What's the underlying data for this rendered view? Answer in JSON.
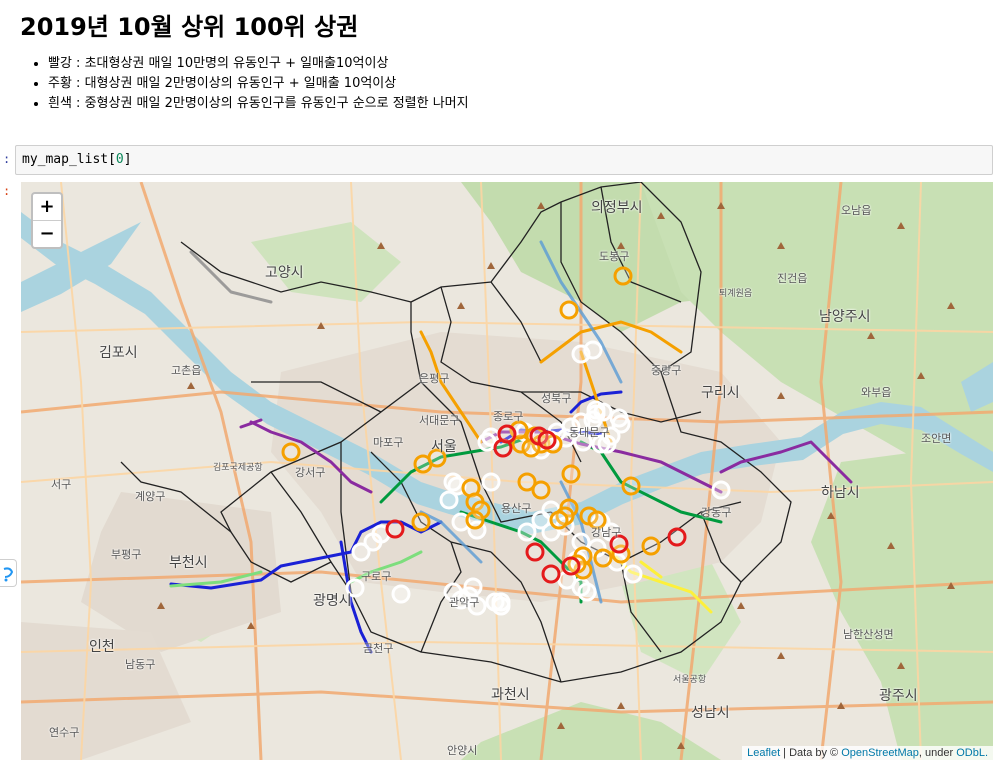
{
  "notebook": {
    "title": "2019년 10월 상위 100위 상권",
    "legend": [
      "빨강 : 초대형상권 매일 10만명의 유동인구 + 일매출10억이상",
      "주황 : 대형상권 매일 2만명이상의 유동인구 + 일매출 10억이상",
      "흰색 : 중형상권 매일 2만명이상의 유동인구를 유동인구 순으로 정렬한 나머지"
    ],
    "code_prefix": "my_map_list[",
    "code_index": "0",
    "code_suffix": "]",
    "in_prompt": ":",
    "out_prompt": ":"
  },
  "map": {
    "zoom_in": "+",
    "zoom_out": "−",
    "attribution": {
      "leaflet": "Leaflet",
      "sep1": " | Data by © ",
      "osm": "OpenStreetMap",
      "sep2": ", under ",
      "odbl": "ODbL."
    },
    "places": [
      "고양시",
      "의정부시",
      "남양주시",
      "김포시",
      "구리시",
      "하남시",
      "부천시",
      "인천",
      "광명시",
      "과천시",
      "성남시",
      "광주시",
      "서울",
      "도봉구",
      "중랑구",
      "은평구",
      "서대문구",
      "마포구",
      "강서구",
      "종로구",
      "성북구",
      "동대문구",
      "용산구",
      "강동구",
      "강남구",
      "구로구",
      "관악구",
      "금천구",
      "남동구",
      "연수구",
      "계양구",
      "부평구",
      "서구",
      "고촌읍",
      "진건읍",
      "와부읍",
      "조안면",
      "오남읍",
      "남한산성면",
      "김포국제공항",
      "서울공항",
      "퇴계원읍",
      "안양시"
    ],
    "circle_colors": {
      "red": "#e41a1c",
      "orange": "#f5a000",
      "white": "#ffffff"
    },
    "counts": {
      "red": 10,
      "orange": 31,
      "white": 59
    }
  }
}
